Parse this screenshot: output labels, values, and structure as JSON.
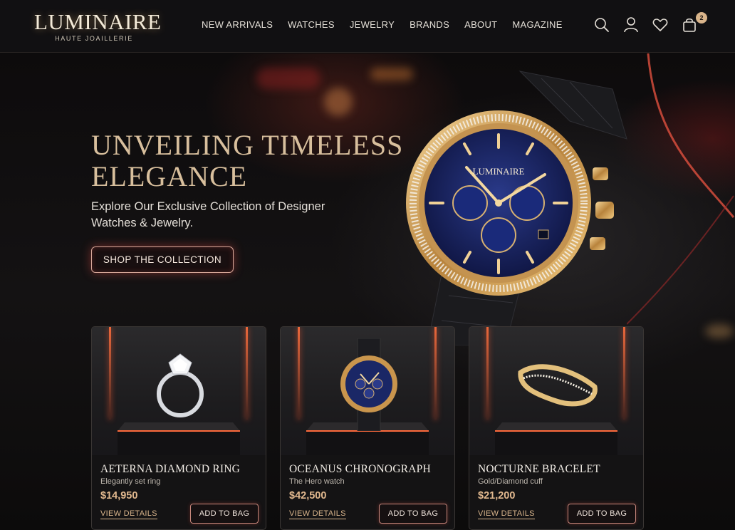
{
  "brand": {
    "name": "LUMINAIRE",
    "tagline": "HAUTE JOAILLERIE"
  },
  "nav": [
    "NEW ARRIVALS",
    "WATCHES",
    "JEWELRY",
    "BRANDS",
    "ABOUT",
    "MAGAZINE"
  ],
  "header_icons": [
    "search-icon",
    "account-icon",
    "wishlist-heart-icon",
    "shopping-bag-icon"
  ],
  "cart_count": "2",
  "hero": {
    "title_line1": "UNVEILING TIMELESS",
    "title_line2": "ELEGANCE",
    "subtitle": "Explore Our Exclusive Collection of Designer Watches & Jewelry.",
    "cta": "SHOP THE COLLECTION",
    "watch_dial_text": "LUMINAIRE"
  },
  "products": [
    {
      "name": "AETERNA DIAMOND RING",
      "desc": "Elegantly set ring",
      "price": "$14,950",
      "link": "VIEW DETAILS",
      "button": "ADD TO BAG"
    },
    {
      "name": "OCEANUS CHRONOGRAPH",
      "desc": "The Hero watch",
      "price": "$42,500",
      "link": "VIEW DETAILS",
      "button": "ADD TO BAG"
    },
    {
      "name": "NOCTURNE BRACELET",
      "desc": "Gold/Diamond cuff",
      "price": "$21,200",
      "link": "VIEW DETAILS",
      "button": "ADD TO BAG"
    }
  ],
  "colors": {
    "accent_gold": "#d8bf9d",
    "price_gold": "#e2b98f",
    "glow_red": "#e0503f",
    "background": "#0b0a0b"
  }
}
